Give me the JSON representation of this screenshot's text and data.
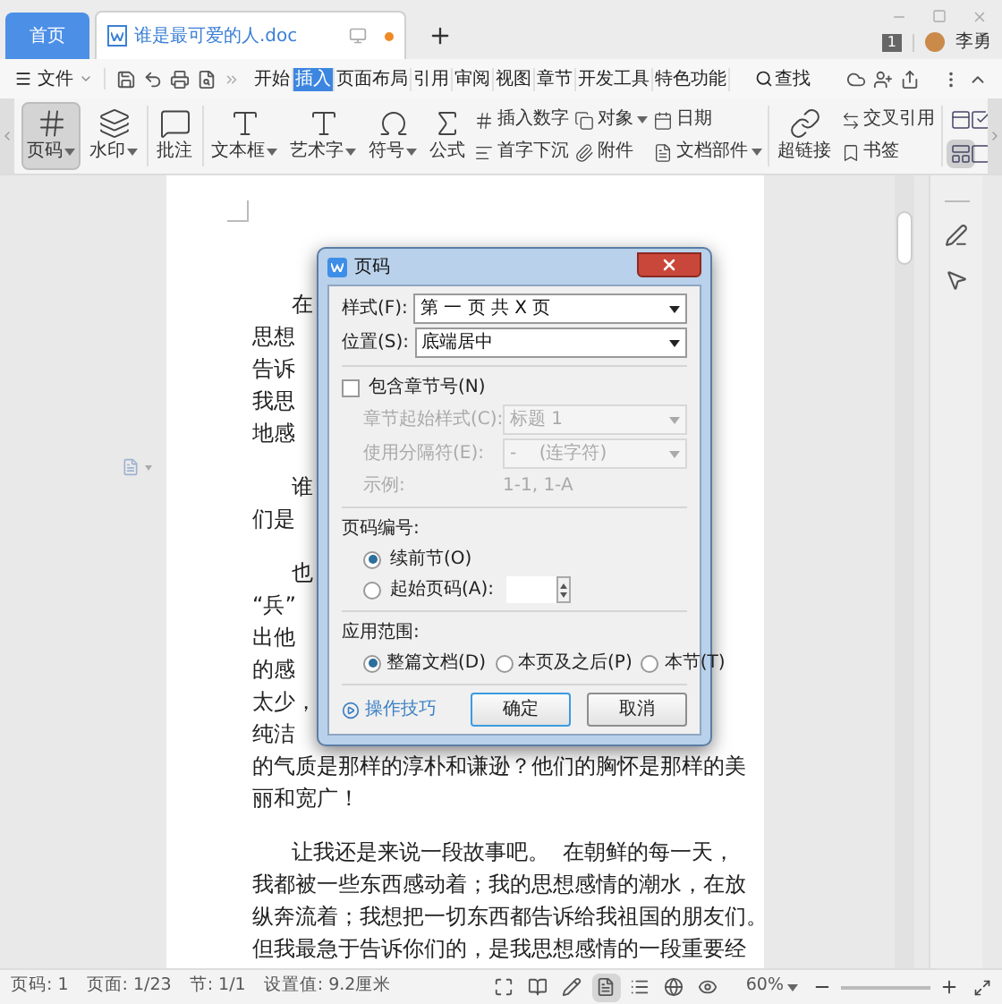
{
  "title_bar": {
    "tabs": [
      {
        "label": "首页",
        "kind": "home",
        "selected": false
      },
      {
        "label": "谁是最可爱的人.doc",
        "kind": "document",
        "selected": true
      }
    ],
    "badge": "1",
    "user": "李勇"
  },
  "menu_bar": {
    "file_menu": "文件",
    "tabs": [
      {
        "label": "开始",
        "selected": false
      },
      {
        "label": "插入",
        "selected": true
      },
      {
        "label": "页面布局",
        "selected": false
      },
      {
        "label": "引用",
        "selected": false
      },
      {
        "label": "审阅",
        "selected": false
      },
      {
        "label": "视图",
        "selected": false
      },
      {
        "label": "章节",
        "selected": false
      },
      {
        "label": "开发工具",
        "selected": false
      },
      {
        "label": "特色功能",
        "selected": false
      }
    ],
    "search": "查找"
  },
  "ribbon": {
    "items": [
      {
        "kind": "large",
        "label": "页码",
        "dropdown": true,
        "selected": true
      },
      {
        "kind": "large",
        "label": "水印",
        "dropdown": true,
        "selected": false
      },
      {
        "kind": "separator"
      },
      {
        "kind": "large",
        "label": "批注",
        "dropdown": false,
        "selected": false
      },
      {
        "kind": "separator"
      },
      {
        "kind": "large",
        "label": "文本框",
        "dropdown": true,
        "selected": false
      },
      {
        "kind": "large",
        "label": "艺术字",
        "dropdown": true,
        "selected": false
      },
      {
        "kind": "large",
        "label": "符号",
        "dropdown": true,
        "selected": false
      },
      {
        "kind": "large",
        "label": "公式",
        "dropdown": false,
        "selected": false
      },
      {
        "kind": "stack",
        "children": [
          {
            "label": "插入数字",
            "dropdown": false
          },
          {
            "label": "首字下沉",
            "dropdown": false
          }
        ]
      },
      {
        "kind": "stack",
        "children": [
          {
            "label": "对象",
            "dropdown": true
          },
          {
            "label": "附件",
            "dropdown": false
          }
        ]
      },
      {
        "kind": "stack",
        "children": [
          {
            "label": "日期",
            "dropdown": false
          },
          {
            "label": "文档部件",
            "dropdown": true
          }
        ]
      },
      {
        "kind": "separator"
      },
      {
        "kind": "large",
        "label": "超链接",
        "dropdown": false,
        "selected": false
      },
      {
        "kind": "stack",
        "children": [
          {
            "label": "交叉引用",
            "dropdown": false
          },
          {
            "label": "书签",
            "dropdown": false
          }
        ]
      },
      {
        "kind": "separator"
      },
      {
        "kind": "grid",
        "cells": [
          {
            "selected": false
          },
          {
            "selected": false
          },
          {
            "selected": true
          },
          {
            "selected": false
          }
        ]
      }
    ]
  },
  "document": {
    "paragraphs": [
      {
        "lines": [
          "在",
          "思想",
          "告诉",
          "我思",
          "地感"
        ]
      },
      {
        "lines": [
          "谁",
          "们是"
        ]
      },
      {
        "lines": [
          "也",
          "“兵”",
          "出他",
          "的感",
          "太少，",
          "纯洁",
          "的气质是那样的淳朴和谦逊？他们的胸怀是那样的美",
          "丽和宽广！"
        ]
      },
      {
        "lines": [
          "让我还是来说一段故事吧。  在朝鲜的每一天，",
          "我都被一些东西感动着；我的思想感情的潮水，在放",
          "纵奔流着；我想把一切东西都告诉给我祖国的朋友们。",
          "但我最急于告诉你们的，是我思想感情的一段重要经"
        ]
      }
    ]
  },
  "dialog": {
    "title": "页码",
    "style": {
      "label": "样式(F):",
      "value": "第 一 页 共 X 页"
    },
    "position": {
      "label": "位置(S):",
      "value": "底端居中"
    },
    "include_chapter": {
      "label": "包含章节号(N)",
      "checked": false
    },
    "chapter_fields": [
      {
        "label": "章节起始样式(C):",
        "value": "标题 1",
        "disabled": true
      },
      {
        "label": "使用分隔符(E):",
        "value": "-    (连字符)",
        "disabled": true
      }
    ],
    "example": {
      "label": "示例:",
      "value": "1-1, 1-A"
    },
    "numbering": {
      "heading": "页码编号:",
      "options": [
        {
          "label": "续前节(O)",
          "selected": true,
          "kind": "plain"
        },
        {
          "label": "起始页码(A):",
          "selected": false,
          "kind": "spin"
        }
      ]
    },
    "scope": {
      "heading": "应用范围:",
      "options": [
        {
          "label": "整篇文档(D)",
          "selected": true
        },
        {
          "label": "本页及之后(P)",
          "selected": false
        },
        {
          "label": "本节(T)",
          "selected": false
        }
      ]
    },
    "tips_link": "操作技巧",
    "buttons": [
      {
        "label": "确定",
        "default": true
      },
      {
        "label": "取消",
        "default": false
      }
    ]
  },
  "status_bar": {
    "items": [
      "页码: 1",
      "页面: 1/23",
      "节: 1/1",
      "设置值: 9.2厘米"
    ],
    "view_buttons": [
      {
        "selected": false
      },
      {
        "selected": false
      },
      {
        "selected": false
      },
      {
        "selected": true
      },
      {
        "selected": false
      },
      {
        "selected": false
      },
      {
        "selected": false
      }
    ],
    "zoom": "60%"
  }
}
